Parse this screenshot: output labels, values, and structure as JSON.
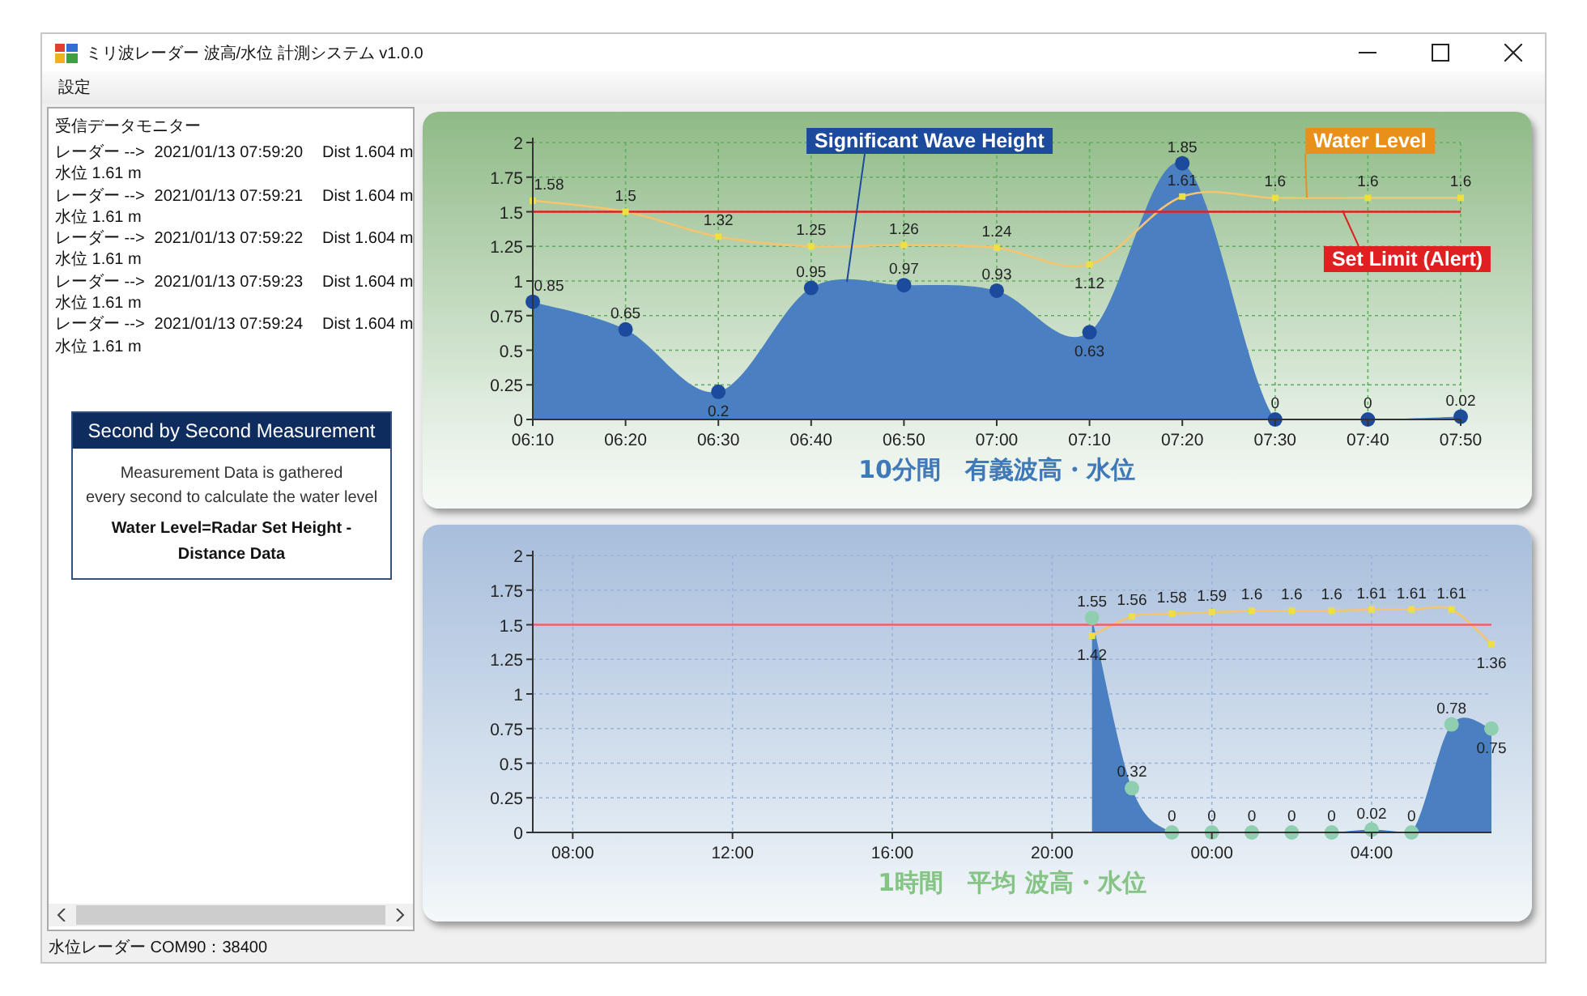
{
  "window": {
    "title": "ミリ波レーダー 波高/水位 計測システム v1.0.0"
  },
  "menu": [
    "設定"
  ],
  "monitor": {
    "title": "受信データモニター",
    "entries": [
      {
        "source": "レーダー -->",
        "time": "2021/01/13 07:59:20",
        "dist": "Dist 1.604 m",
        "level": "水位 1.61 m"
      },
      {
        "source": "レーダー -->",
        "time": "2021/01/13 07:59:21",
        "dist": "Dist 1.604 m",
        "level": "水位 1.61 m"
      },
      {
        "source": "レーダー -->",
        "time": "2021/01/13 07:59:22",
        "dist": "Dist 1.604 m",
        "level": "水位 1.61 m"
      },
      {
        "source": "レーダー -->",
        "time": "2021/01/13 07:59:23",
        "dist": "Dist 1.604 m",
        "level": "水位 1.61 m"
      },
      {
        "source": "レーダー -->",
        "time": "2021/01/13 07:59:24",
        "dist": "Dist 1.604 m",
        "level": "水位 1.61 m"
      }
    ]
  },
  "info_box": {
    "title": "Second by Second Measurement",
    "lines": [
      "Measurement Data is gathered",
      "every second to calculate the water level"
    ],
    "formula": "Water Level=Radar Set Height - Distance Data"
  },
  "charts": [
    {
      "chart_data": {
        "type": "area",
        "title": "10分間　有義波高・水位",
        "categories": [
          "06:10",
          "06:20",
          "06:30",
          "06:40",
          "06:50",
          "07:00",
          "07:10",
          "07:20",
          "07:30",
          "07:40",
          "07:50"
        ],
        "series": [
          {
            "name": "Significant Wave Height",
            "type": "area",
            "color": "#4a7fc1",
            "marker": "circle",
            "values": [
              0.85,
              0.65,
              0.2,
              0.95,
              0.97,
              0.93,
              0.63,
              1.85,
              0,
              0,
              0.02
            ]
          },
          {
            "name": "Water Level",
            "type": "line",
            "color": "#f5c46e",
            "marker": "square",
            "values": [
              1.58,
              1.5,
              1.32,
              1.25,
              1.26,
              1.24,
              1.12,
              1.61,
              1.6,
              1.6,
              1.6
            ]
          }
        ],
        "ylim": [
          0,
          2
        ],
        "yticks": [
          0,
          0.25,
          0.5,
          0.75,
          1,
          1.25,
          1.5,
          1.75,
          2
        ],
        "grid": true,
        "data_labels": true,
        "ref_lines": [
          {
            "axis": "y",
            "value": 1.5,
            "color": "#e02020",
            "label": "Set Limit (Alert)"
          }
        ]
      }
    },
    {
      "chart_data": {
        "type": "area",
        "title": "1時間　平均 波高・水位",
        "categories": [
          null,
          "08:00",
          null,
          null,
          null,
          "12:00",
          null,
          null,
          null,
          "16:00",
          null,
          null,
          null,
          "20:00",
          null,
          null,
          null,
          "00:00",
          null,
          null,
          null,
          "04:00",
          null,
          null,
          null
        ],
        "series": [
          {
            "type": "area",
            "color": "#4a7fc1",
            "marker": "circle",
            "values": [
              null,
              null,
              null,
              null,
              null,
              null,
              null,
              null,
              null,
              null,
              null,
              null,
              null,
              null,
              1.55,
              0.32,
              0,
              0,
              0,
              0,
              0,
              0.02,
              0,
              0.78,
              0.75
            ]
          },
          {
            "type": "line",
            "color": "#f5c46e",
            "marker": "square",
            "values": [
              null,
              null,
              null,
              null,
              null,
              null,
              null,
              null,
              null,
              null,
              null,
              null,
              null,
              null,
              1.42,
              1.56,
              1.58,
              1.59,
              1.6,
              1.6,
              1.6,
              1.61,
              1.61,
              1.61,
              1.36
            ]
          }
        ],
        "ylim": [
          0,
          2
        ],
        "yticks": [
          0,
          0.25,
          0.5,
          0.75,
          1,
          1.25,
          1.5,
          1.75,
          2
        ],
        "grid": true,
        "data_labels": true,
        "ref_lines": [
          {
            "axis": "y",
            "value": 1.5,
            "color": "#f06060"
          }
        ]
      }
    }
  ],
  "status_bar": "水位レーダー COM90：38400"
}
